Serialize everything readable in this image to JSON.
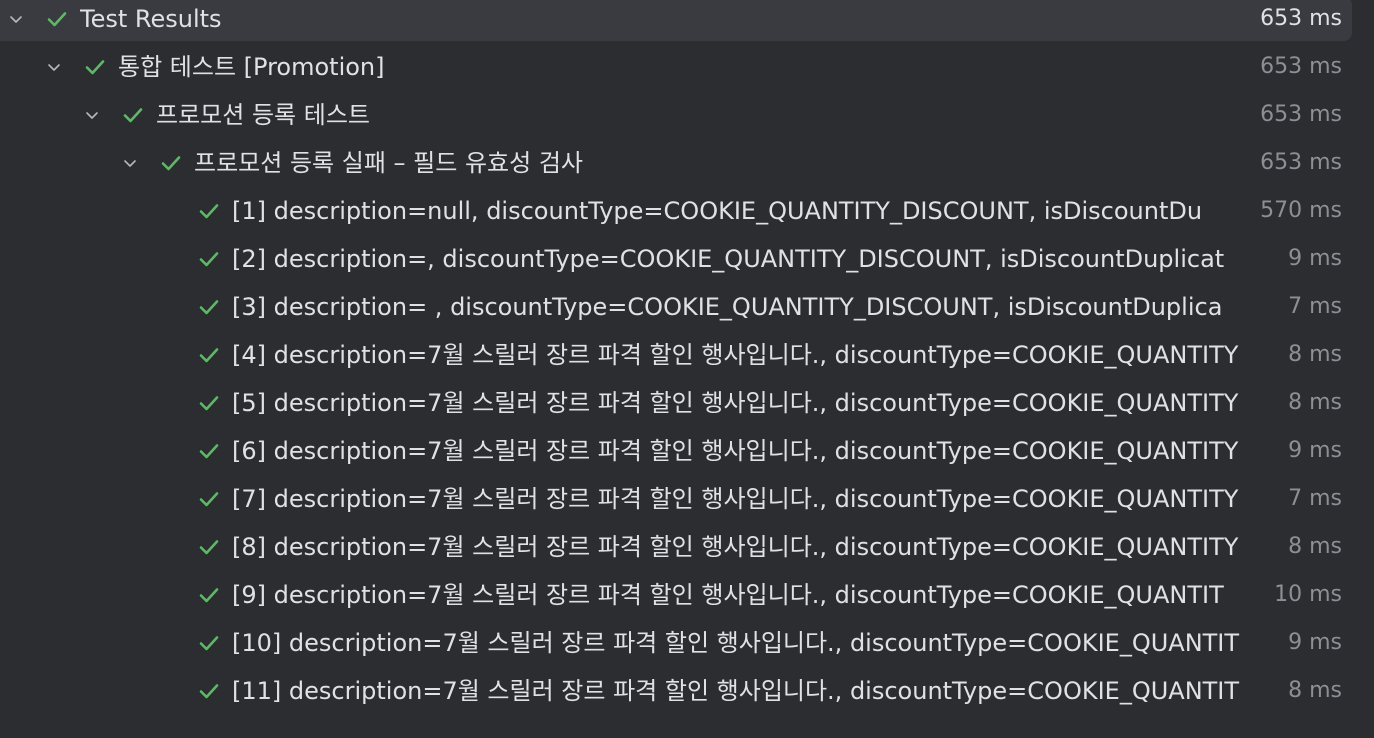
{
  "tree": {
    "root": {
      "label": "Test Results",
      "duration": "653 ms"
    },
    "suite": {
      "label": "통합 테스트 [Promotion]",
      "duration": "653 ms"
    },
    "class": {
      "label": "프로모션 등록 테스트",
      "duration": "653 ms"
    },
    "method": {
      "label": "프로모션 등록 실패 – 필드 유효성 검사",
      "duration": "653 ms"
    },
    "cases": [
      {
        "label": "[1] description=null, discountType=COOKIE_QUANTITY_DISCOUNT, isDiscountDu",
        "duration": "570 ms"
      },
      {
        "label": "[2] description=, discountType=COOKIE_QUANTITY_DISCOUNT, isDiscountDuplicat",
        "duration": "9 ms"
      },
      {
        "label": "[3] description= , discountType=COOKIE_QUANTITY_DISCOUNT, isDiscountDuplica",
        "duration": "7 ms"
      },
      {
        "label": "[4] description=7월 스릴러 장르 파격 할인 행사입니다., discountType=COOKIE_QUANTITY",
        "duration": "8 ms"
      },
      {
        "label": "[5] description=7월 스릴러 장르 파격 할인 행사입니다., discountType=COOKIE_QUANTITY",
        "duration": "8 ms"
      },
      {
        "label": "[6] description=7월 스릴러 장르 파격 할인 행사입니다., discountType=COOKIE_QUANTITY",
        "duration": "9 ms"
      },
      {
        "label": "[7] description=7월 스릴러 장르 파격 할인 행사입니다., discountType=COOKIE_QUANTITY",
        "duration": "7 ms"
      },
      {
        "label": "[8] description=7월 스릴러 장르 파격 할인 행사입니다., discountType=COOKIE_QUANTITY",
        "duration": "8 ms"
      },
      {
        "label": "[9] description=7월 스릴러 장르 파격 할인 행사입니다., discountType=COOKIE_QUANTIT",
        "duration": "10 ms"
      },
      {
        "label": "[10] description=7월 스릴러 장르 파격 할인 행사입니다., discountType=COOKIE_QUANTIT",
        "duration": "9 ms"
      },
      {
        "label": "[11] description=7월 스릴러 장르 파격 할인 행사입니다., discountType=COOKIE_QUANTIT",
        "duration": "8 ms"
      }
    ]
  },
  "icons": {
    "expand": "chevron-down-icon",
    "passed": "check-icon"
  },
  "colors": {
    "background": "#2b2d30",
    "selected_row": "#393b40",
    "passed": "#5fb865",
    "text": "#dfe1e5",
    "duration_text": "#8c8f94"
  }
}
